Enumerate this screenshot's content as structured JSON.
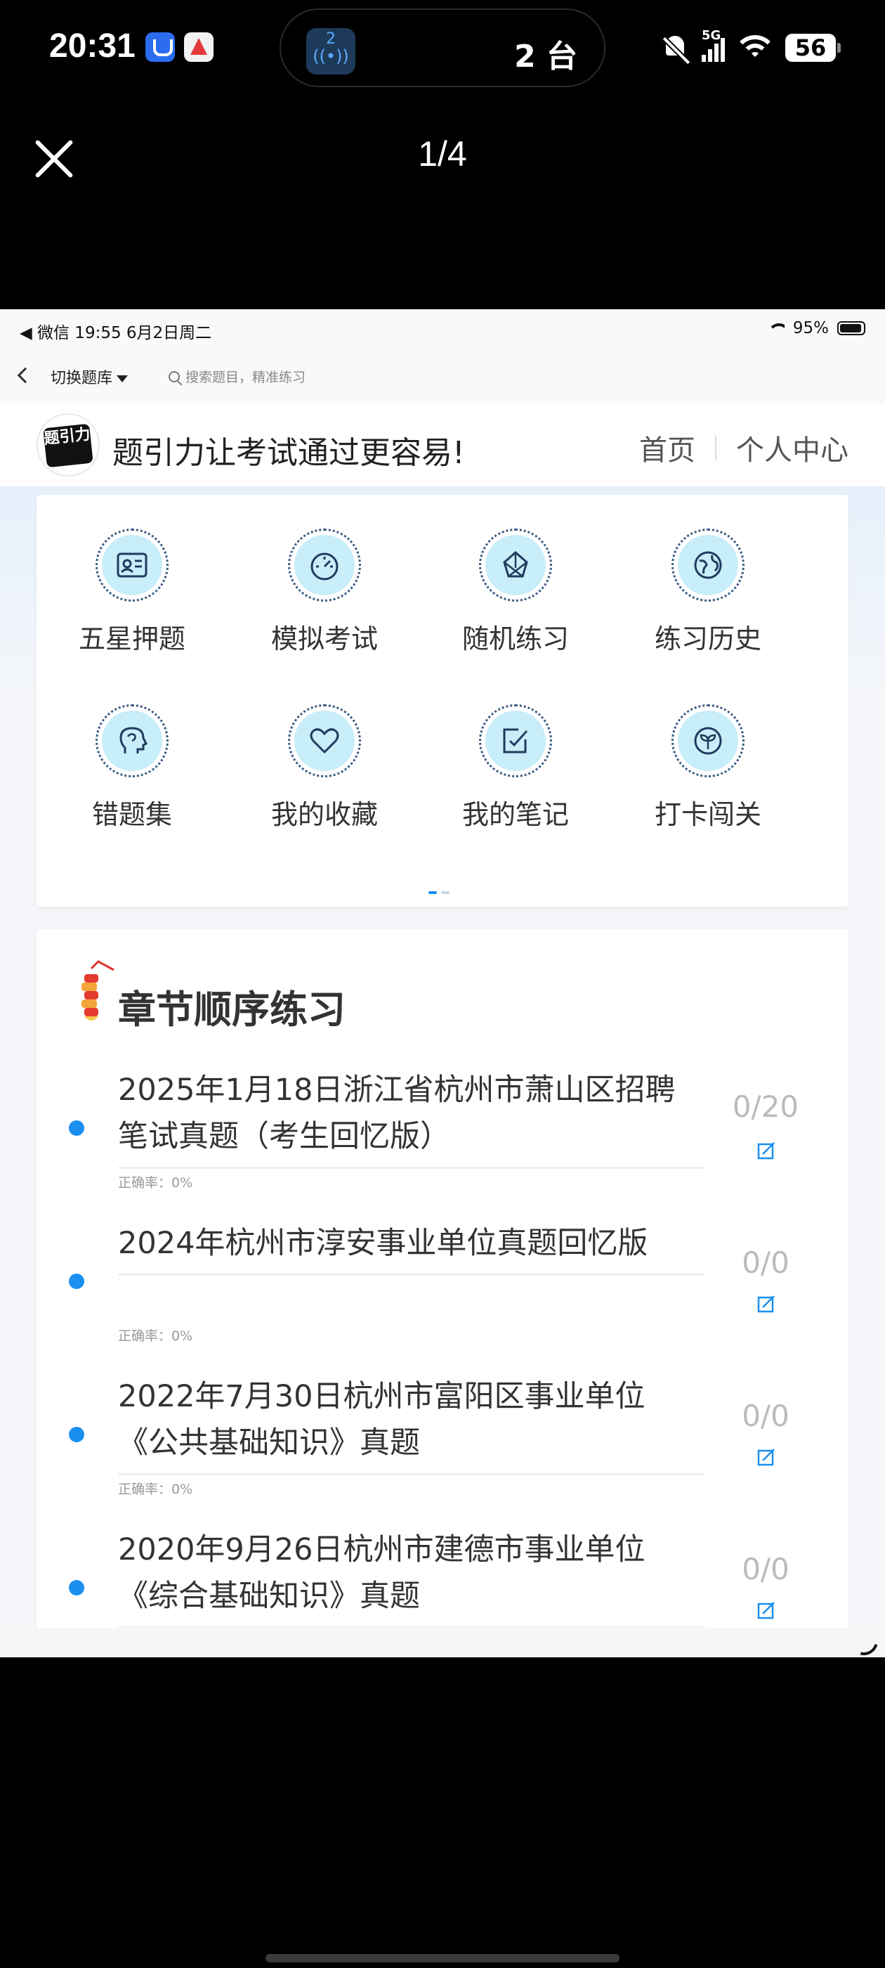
{
  "os_status": {
    "time": "20:31",
    "island_count": "2",
    "island_text": "2 台",
    "network": "5G",
    "battery": "56"
  },
  "viewer": {
    "page_indicator": "1/4"
  },
  "inner_status": {
    "left": "◀ 微信   19:55   6月2日周二",
    "battery": "95%"
  },
  "topbar": {
    "switch_label": "切换题库",
    "search_placeholder": "搜索题目，精准练习"
  },
  "brand": {
    "logo_text": "题引力",
    "slogan": "题引力让考试通过更容易!",
    "nav": [
      "首页",
      "个人中心"
    ]
  },
  "grid": [
    {
      "label": "五星押题",
      "icon": "id-card-icon"
    },
    {
      "label": "模拟考试",
      "icon": "speedometer-icon"
    },
    {
      "label": "随机练习",
      "icon": "shuffle-icon"
    },
    {
      "label": "练习历史",
      "icon": "globe-icon"
    },
    {
      "label": "错题集",
      "icon": "head-icon"
    },
    {
      "label": "我的收藏",
      "icon": "heart-icon"
    },
    {
      "label": "我的笔记",
      "icon": "note-check-icon"
    },
    {
      "label": "打卡闯关",
      "icon": "sprout-icon"
    }
  ],
  "chapter": {
    "title": "章节顺序练习",
    "items": [
      {
        "title": "2025年1月18日浙江省杭州市萧山区招聘笔试真题（考生回忆版）",
        "accuracy": "正确率：0%",
        "count": "0/20"
      },
      {
        "title": "2024年杭州市淳安事业单位真题回忆版",
        "accuracy": "正确率：0%",
        "count": "0/0"
      },
      {
        "title": "2022年7月30日杭州市富阳区事业单位《公共基础知识》真题",
        "accuracy": "正确率：0%",
        "count": "0/0"
      },
      {
        "title": "2020年9月26日杭州市建德市事业单位《综合基础知识》真题",
        "accuracy": "",
        "count": "0/0"
      }
    ]
  },
  "colors": {
    "accent": "#1a8ff0",
    "icon_fill": "#c8eef9",
    "icon_ring": "#3a5a80"
  }
}
